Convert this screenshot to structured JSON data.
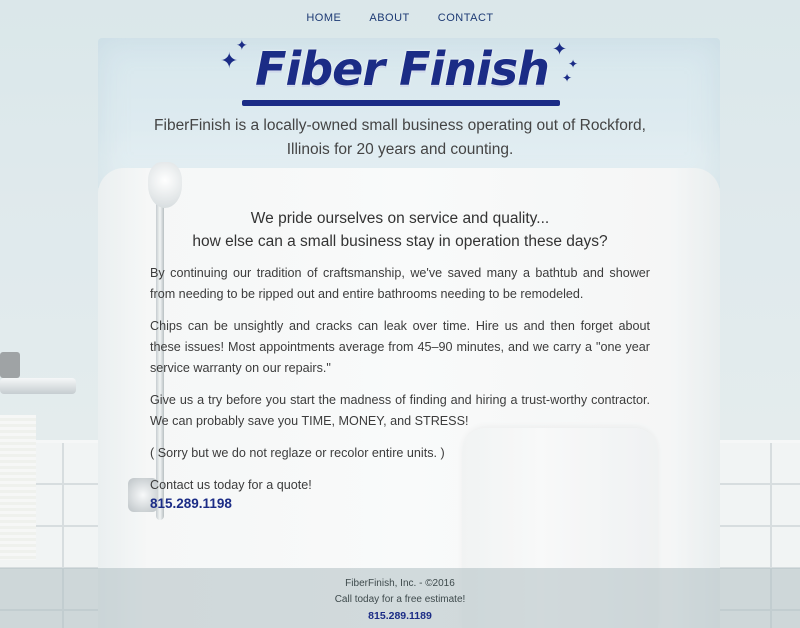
{
  "nav": {
    "items": [
      {
        "label": "HOME"
      },
      {
        "label": "ABOUT"
      },
      {
        "label": "CONTACT"
      }
    ]
  },
  "logo": {
    "text": "Fiber Finish",
    "sparkle_glyph": "✦",
    "color": "#1b2c86"
  },
  "tagline": "FiberFinish is a locally-owned small business operating out of Rockford, Illinois for 20 years and counting.",
  "heading": {
    "line1": "We pride ourselves on service and quality...",
    "line2": "how else can a small business stay in operation these days?"
  },
  "body": {
    "p1": "By continuing our tradition of craftsmanship, we've saved many a bathtub and shower from needing to be ripped out and entire bathrooms needing to be remodeled.",
    "p2": "Chips can be unsightly and cracks can leak over time. Hire us and then forget about these issues! Most appointments average from 45–90 minutes, and we carry a \"one year service warranty on our repairs.\"",
    "p3": "Give us a try before you start the madness of finding and hiring a trust-worthy contractor. We can probably save you TIME, MONEY, and STRESS!",
    "p4": "( Sorry but we do not reglaze or recolor entire units. )",
    "contact_prompt": "Contact us today for a quote!",
    "phone": "815.289.1198"
  },
  "footer": {
    "copyright": "FiberFinish, Inc. - ©2016",
    "cta": "Call today for a free estimate!",
    "phone": "815.289.1189"
  },
  "colors": {
    "brand": "#1b2c86",
    "nav_link": "#1d3a74"
  }
}
